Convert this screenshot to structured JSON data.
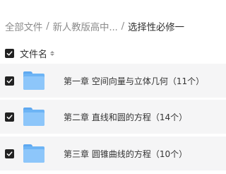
{
  "breadcrumb": {
    "root": "全部文件",
    "separator": "/",
    "middle": "新人教版高中...",
    "current": "选择性必修一"
  },
  "header": {
    "column_title": "文件名"
  },
  "files": [
    {
      "name": "第一章 空间向量与立体几何（11个）",
      "checked": true
    },
    {
      "name": "第二章 直线和圆的方程（14个）",
      "checked": true
    },
    {
      "name": "第三章 圆锥曲线的方程（10个）",
      "checked": true
    }
  ],
  "colors": {
    "row_background": "#f5f5f6",
    "checkbox": "#222222",
    "folder": "#8dc6fa"
  }
}
